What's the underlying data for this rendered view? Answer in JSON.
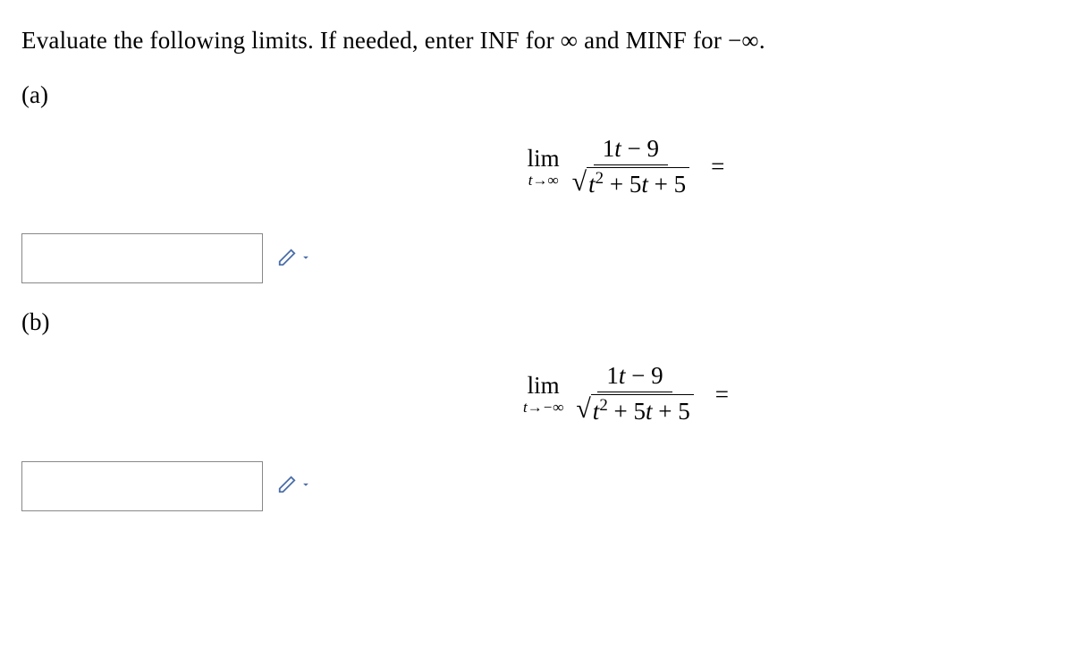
{
  "instruction": "Evaluate the following limits. If needed, enter INF for ∞ and MINF for −∞.",
  "parts": {
    "a": {
      "label": "(a)",
      "lim_word": "lim",
      "lim_sub": "t→∞",
      "numerator": "1t − 9",
      "radicand_t2": "t",
      "radicand_exp": "2",
      "radicand_rest": " + 5t + 5",
      "equals": "="
    },
    "b": {
      "label": "(b)",
      "lim_word": "lim",
      "lim_sub": "t→−∞",
      "numerator": "1t − 9",
      "radicand_t2": "t",
      "radicand_exp": "2",
      "radicand_rest": " + 5t + 5",
      "equals": "="
    }
  },
  "inputs": {
    "a_value": "",
    "b_value": ""
  }
}
